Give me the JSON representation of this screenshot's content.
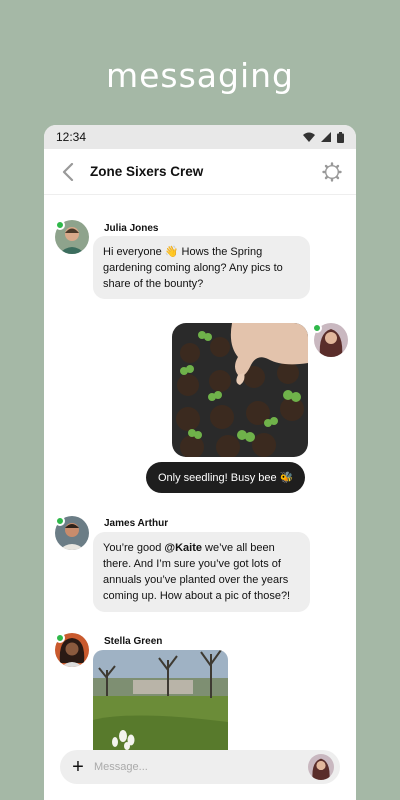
{
  "headline": "messaging",
  "status_bar": {
    "time": "12:34"
  },
  "app_bar": {
    "title": "Zone Sixers Crew",
    "back_icon": "chevron-left-icon",
    "settings_icon": "gear-icon"
  },
  "messages": [
    {
      "sender": "Julia Jones",
      "lines": [
        "Hi everyone 👋 Hows the Spring",
        "gardening coming along? Any pics to",
        "share of the bounty?"
      ]
    },
    {
      "from_me": true,
      "caption": "Only seedling! Busy bee 🐝"
    },
    {
      "sender": "James Arthur",
      "lines_pre": "You’re good ",
      "mention": "@Kaite",
      "lines_post": " we’ve all been",
      "line2": "there.  And I’m sure you’ve got lots of",
      "line3": "annuals you’ve planted over the years",
      "line4": "coming up. How about a pic of those?!"
    },
    {
      "sender": "Stella Green"
    }
  ],
  "composer": {
    "placeholder": "Message...",
    "plus_icon": "plus-icon"
  },
  "colors": {
    "background": "#a5b8a6",
    "online": "#2fb84a",
    "bubble": "#eeeeee",
    "dark_bubble": "#1e1e1e"
  }
}
